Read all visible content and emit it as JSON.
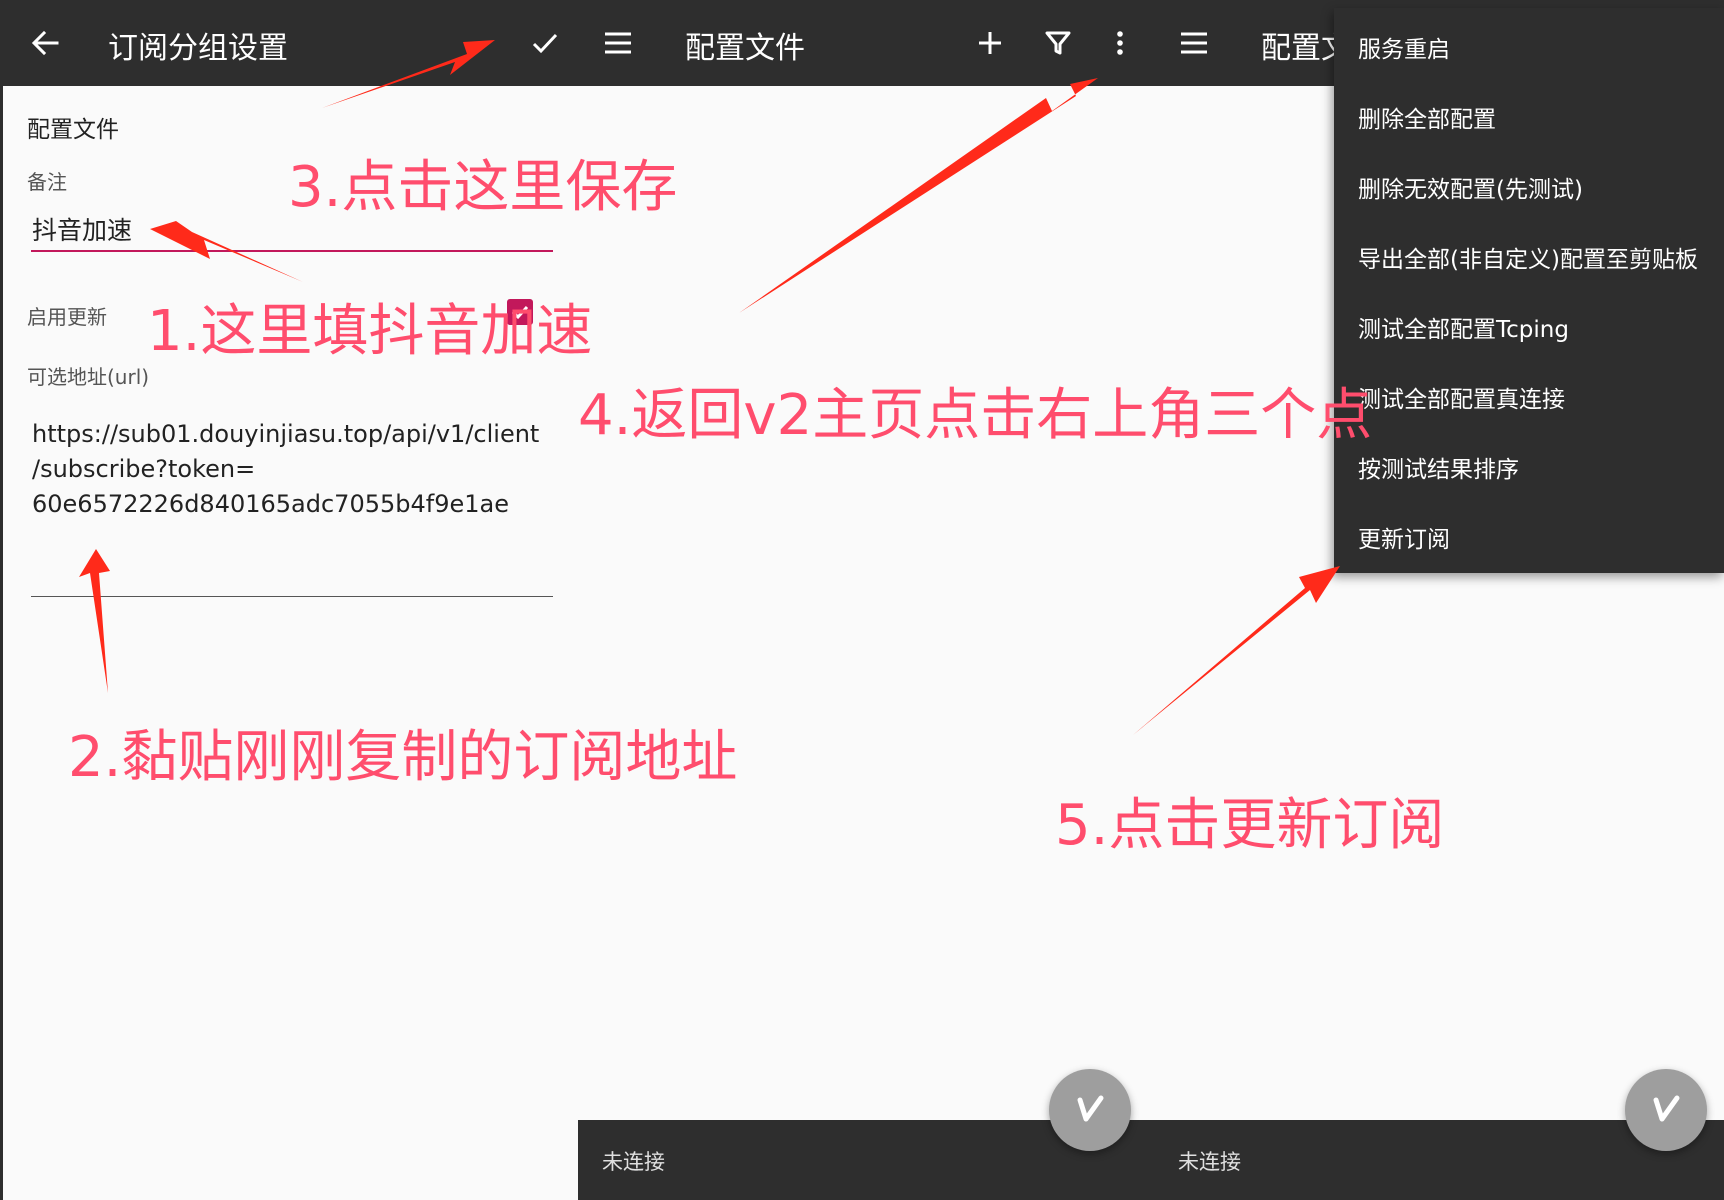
{
  "panel1": {
    "title": "订阅分组设置",
    "back_icon": "arrow-back-icon",
    "save_icon": "check-icon",
    "section_title": "配置文件",
    "remarks_label": "备注",
    "remarks_value": "抖音加速",
    "enable_update_label": "启用更新",
    "enable_update_checked": true,
    "url_label": "可选地址(url)",
    "url_value": "https://sub01.douyinjiasu.top/api/v1/client\n/subscribe?token=\n60e6572226d840165adc7055b4f9e1ae",
    "accent_color": "#c2185b"
  },
  "panel2": {
    "title": "配置文件",
    "menu_icon": "hamburger-menu-icon",
    "add_icon": "plus-icon",
    "filter_icon": "filter-icon",
    "more_icon": "more-vert-icon",
    "status": "未连接",
    "fab_icon": "v-logo-icon"
  },
  "panel3": {
    "title": "配置文",
    "menu_icon": "hamburger-menu-icon",
    "status": "未连接",
    "fab_icon": "v-logo-icon",
    "overflow_menu": [
      "服务重启",
      "删除全部配置",
      "删除无效配置(先测试)",
      "导出全部(非自定义)配置至剪贴板",
      "测试全部配置Tcping",
      "测试全部配置真连接",
      "按测试结果排序",
      "更新订阅"
    ]
  },
  "annotations": {
    "step1": "1.这里填抖音加速",
    "step2": "2.黏贴刚刚复制的订阅地址",
    "step3": "3.点击这里保存",
    "step4": "4.返回v2主页点击右上角三个点",
    "step5": "5.点击更新订阅",
    "color": "#ff4d6d",
    "arrow_color": "#ff2a1a"
  },
  "colors": {
    "toolbar": "#2e2e2e",
    "background": "#fafafa",
    "fab": "#9e9e9e"
  }
}
